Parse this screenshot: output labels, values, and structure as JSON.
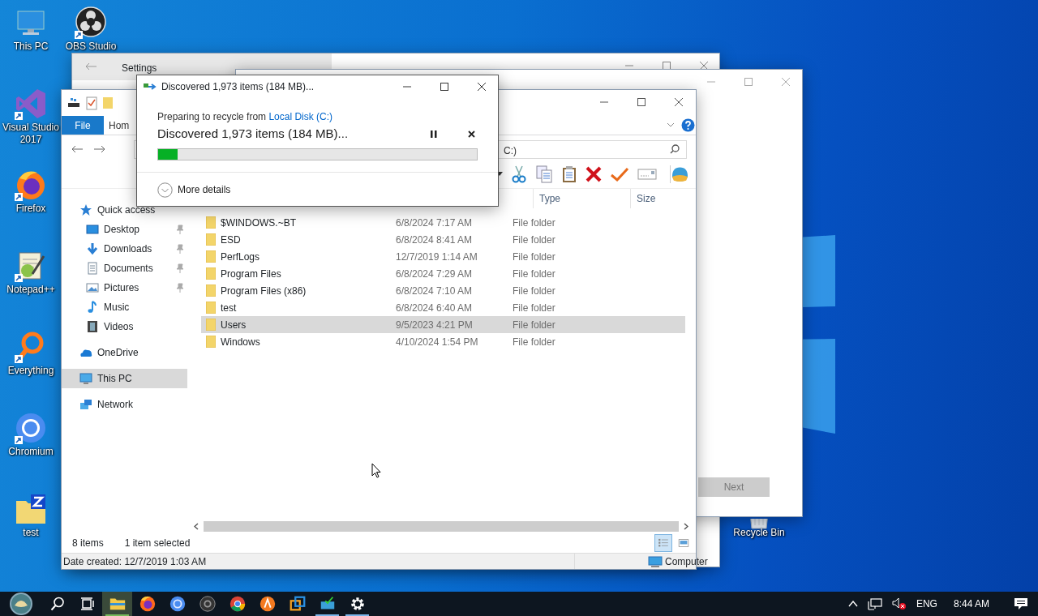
{
  "desktop_icons": [
    {
      "label": "This PC",
      "shortcut": false
    },
    {
      "label": "OBS Studio",
      "shortcut": true
    },
    {
      "label": "Visual Studio 2017",
      "shortcut": true
    },
    {
      "label": "Firefox",
      "shortcut": true
    },
    {
      "label": "Notepad++",
      "shortcut": true
    },
    {
      "label": "Everything",
      "shortcut": true
    },
    {
      "label": "Chromium",
      "shortcut": true
    },
    {
      "label": "test",
      "shortcut": false
    },
    {
      "label": "Recycle Bin",
      "shortcut": false
    }
  ],
  "settings_window": {
    "title": "Settings"
  },
  "setup_window": {
    "next_button": {
      "label": "Next",
      "disabled": true
    }
  },
  "explorer": {
    "ribbon_tabs": [
      {
        "label": "File",
        "kind": "file"
      },
      {
        "label": "Hom",
        "kind": "tab"
      }
    ],
    "address": "C:)",
    "columns": [
      "Type",
      "Size"
    ],
    "nav_items": [
      {
        "label": "Quick access",
        "selected": false,
        "children": [
          {
            "label": "Desktop",
            "pinned": true,
            "selected": false
          },
          {
            "label": "Downloads",
            "pinned": true,
            "selected": false
          },
          {
            "label": "Documents",
            "pinned": true,
            "selected": false
          },
          {
            "label": "Pictures",
            "pinned": true,
            "selected": false
          },
          {
            "label": "Music",
            "pinned": false,
            "selected": false
          },
          {
            "label": "Videos",
            "pinned": false,
            "selected": false
          }
        ]
      },
      {
        "label": "OneDrive",
        "selected": false
      },
      {
        "label": "This PC",
        "selected": true
      },
      {
        "label": "Network",
        "selected": false
      }
    ],
    "files": [
      {
        "name": "$WINDOWS.~BT",
        "date": "6/8/2024 7:17 AM",
        "type": "File folder",
        "selected": false
      },
      {
        "name": "ESD",
        "date": "6/8/2024 8:41 AM",
        "type": "File folder",
        "selected": false
      },
      {
        "name": "PerfLogs",
        "date": "12/7/2019 1:14 AM",
        "type": "File folder",
        "selected": false
      },
      {
        "name": "Program Files",
        "date": "6/8/2024 7:29 AM",
        "type": "File folder",
        "selected": false
      },
      {
        "name": "Program Files (x86)",
        "date": "6/8/2024 7:10 AM",
        "type": "File folder",
        "selected": false
      },
      {
        "name": "test",
        "date": "6/8/2024 6:40 AM",
        "type": "File folder",
        "selected": false
      },
      {
        "name": "Users",
        "date": "9/5/2023 4:21 PM",
        "type": "File folder",
        "selected": true
      },
      {
        "name": "Windows",
        "date": "4/10/2024 1:54 PM",
        "type": "File folder",
        "selected": false
      }
    ],
    "status": {
      "item_count": "8 items",
      "selection": "1 item selected"
    },
    "views": [
      {
        "selected": true
      },
      {
        "selected": false
      }
    ],
    "details_bar": {
      "date_created": "Date created: 12/7/2019 1:03 AM",
      "location": "Computer"
    }
  },
  "progress_dialog": {
    "title": "Discovered 1,973 items (184 MB)...",
    "source_prefix": "Preparing to recycle from ",
    "source_link": "Local Disk (C:)",
    "heading": "Discovered 1,973 items (184 MB)...",
    "level": 0.06,
    "details_toggle": "More details"
  },
  "taskbar": {
    "apps": [
      {
        "active": true,
        "running": true
      },
      {
        "active": false,
        "running": false
      },
      {
        "active": false,
        "running": false
      },
      {
        "active": false,
        "running": false
      },
      {
        "active": false,
        "running": false
      },
      {
        "active": false,
        "running": false
      },
      {
        "active": false,
        "running": false
      },
      {
        "active": false,
        "running": true
      },
      {
        "active": false,
        "running": true
      }
    ],
    "language": "ENG",
    "time": "8:44 AM"
  }
}
